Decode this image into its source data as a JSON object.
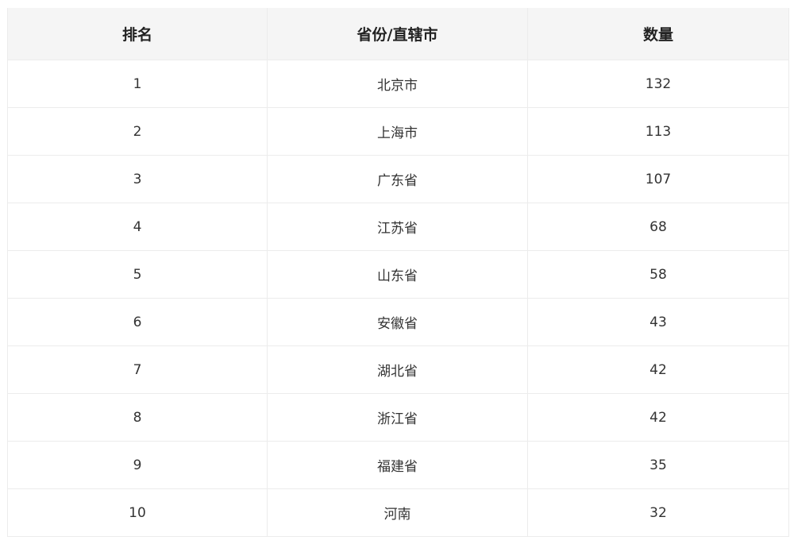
{
  "table": {
    "headers": [
      "排名",
      "省份/直辖市",
      "数量"
    ],
    "rows": [
      [
        "1",
        "北京市",
        "132"
      ],
      [
        "2",
        "上海市",
        "113"
      ],
      [
        "3",
        "广东省",
        "107"
      ],
      [
        "4",
        "江苏省",
        "68"
      ],
      [
        "5",
        "山东省",
        "58"
      ],
      [
        "6",
        "安徽省",
        "43"
      ],
      [
        "7",
        "湖北省",
        "42"
      ],
      [
        "8",
        "浙江省",
        "42"
      ],
      [
        "9",
        "福建省",
        "35"
      ],
      [
        "10",
        "河南",
        "32"
      ]
    ]
  }
}
